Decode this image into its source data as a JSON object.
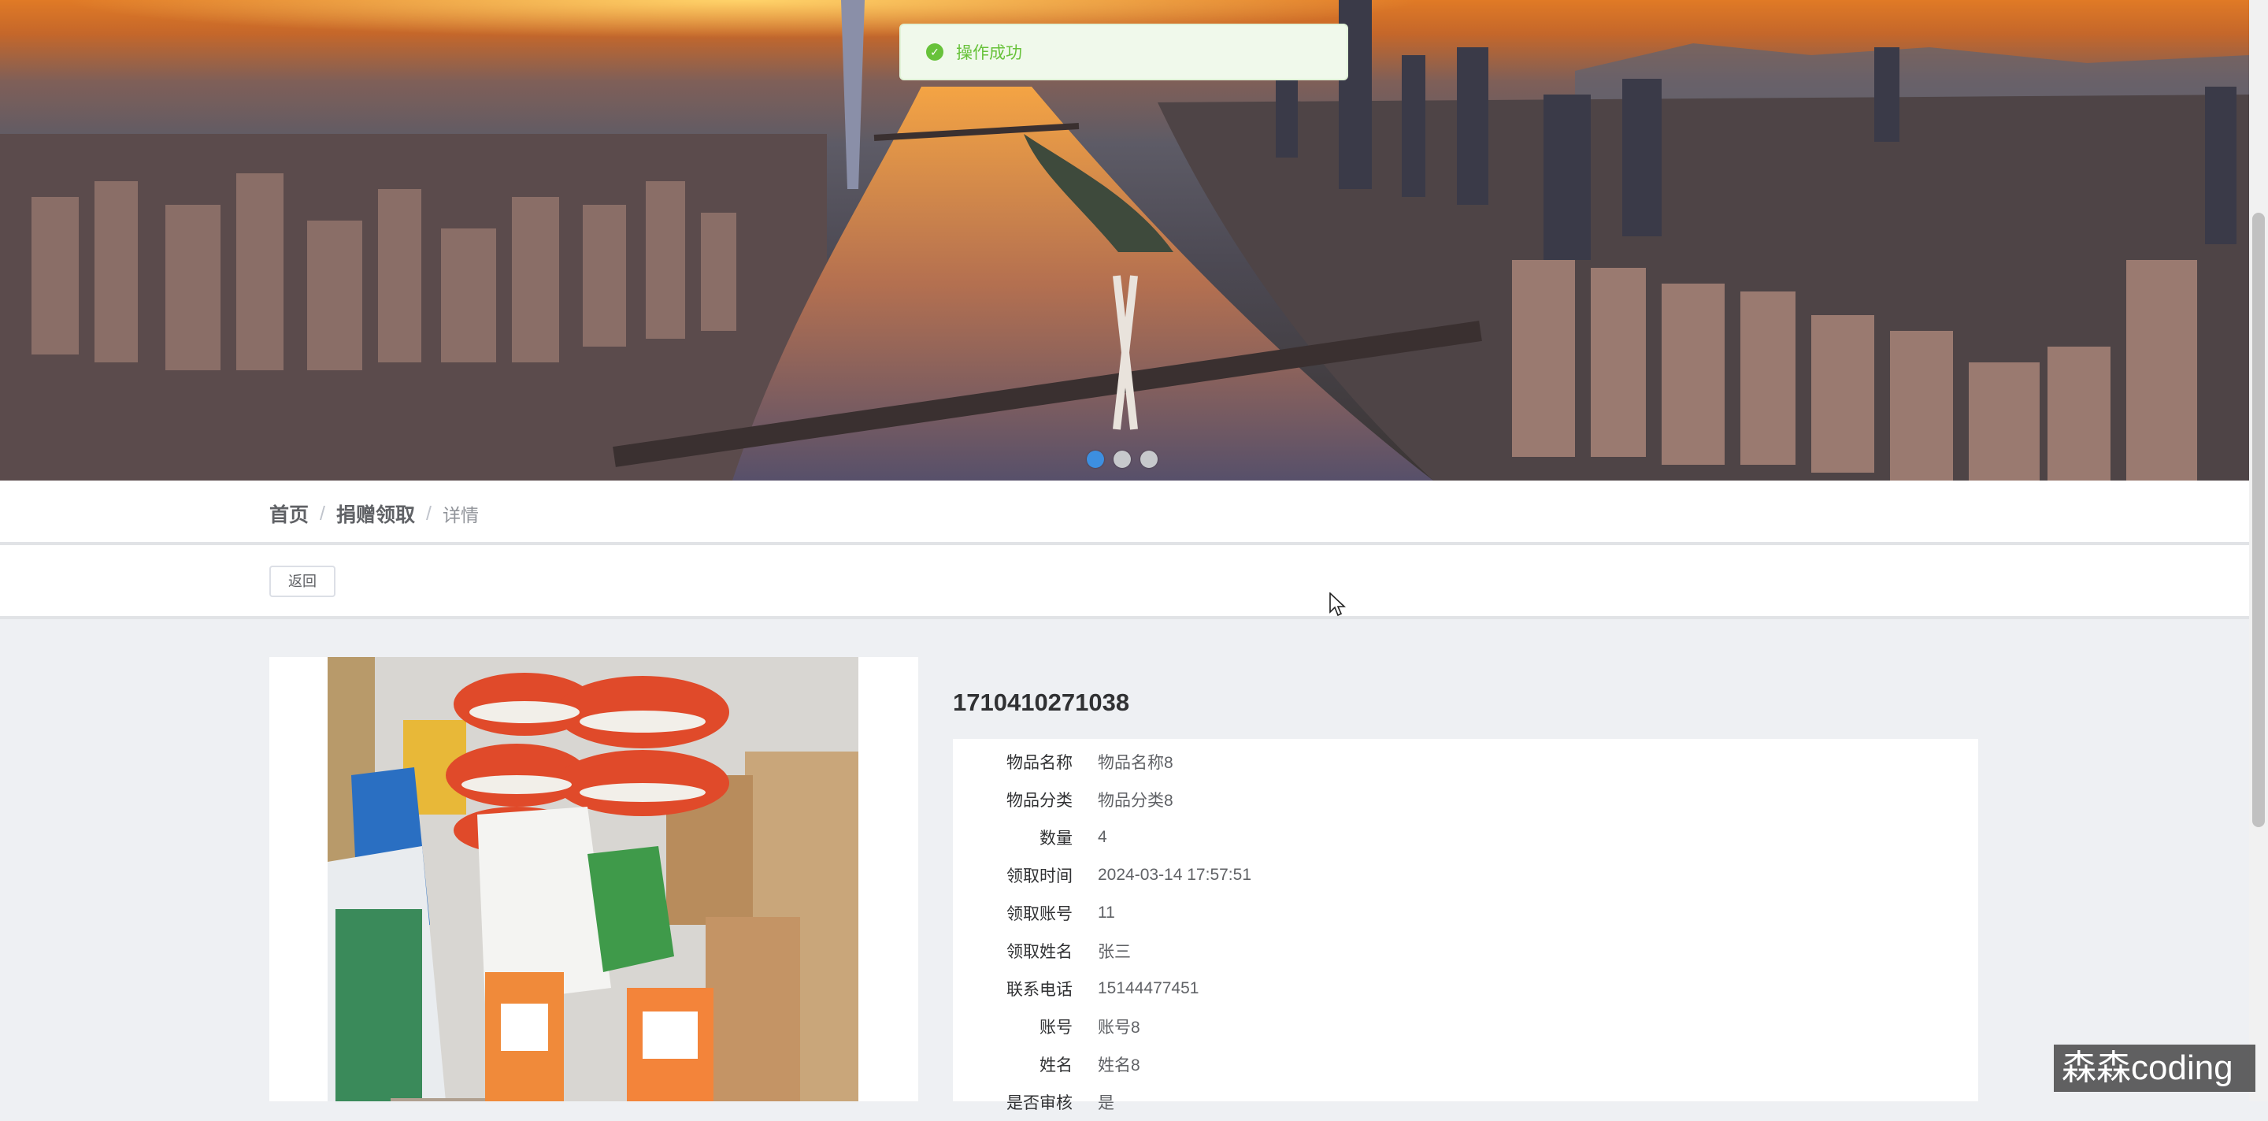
{
  "toast": {
    "message": "操作成功",
    "icon": "check-circle-icon",
    "color": "#67c23a"
  },
  "banner": {
    "slide_count": 3,
    "active_slide": 1
  },
  "breadcrumb": {
    "home": "首页",
    "section": "捐赠领取",
    "current": "详情",
    "separator": "/"
  },
  "actions": {
    "back_label": "返回"
  },
  "detail": {
    "title": "1710410271038",
    "fields": [
      {
        "label": "物品名称",
        "value": "物品名称8"
      },
      {
        "label": "物品分类",
        "value": "物品分类8"
      },
      {
        "label": "数量",
        "value": "4"
      },
      {
        "label": "领取时间",
        "value": "2024-03-14 17:57:51"
      },
      {
        "label": "领取账号",
        "value": "11"
      },
      {
        "label": "领取姓名",
        "value": "张三"
      },
      {
        "label": "联系电话",
        "value": "15144477451"
      },
      {
        "label": "账号",
        "value": "账号8"
      },
      {
        "label": "姓名",
        "value": "姓名8"
      },
      {
        "label": "是否审核",
        "value": "是"
      }
    ]
  },
  "watermark": "森森coding",
  "colors": {
    "accent": "#3d8fe0",
    "success": "#67c23a",
    "page_bg": "#eef0f3"
  }
}
